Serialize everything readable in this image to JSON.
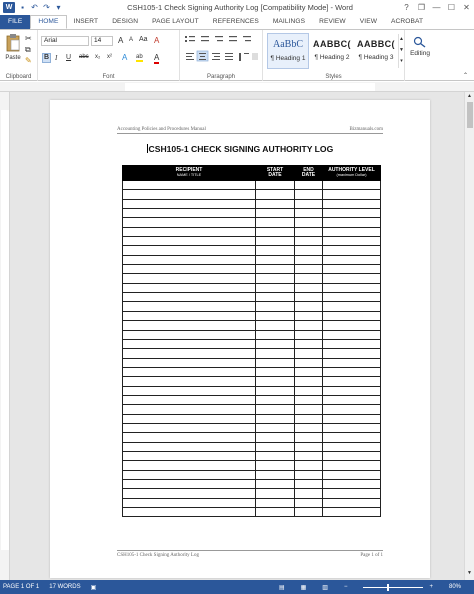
{
  "window": {
    "title": "CSH105-1 Check Signing Authority Log [Compatibility Mode] - Word",
    "help": "?",
    "restore": "❐",
    "minimize": "—",
    "maximize": "☐",
    "close": "✕"
  },
  "quick_access": {
    "app_letter": "W",
    "save": "▪",
    "undo": "↶",
    "redo": "↷",
    "customize": "▾"
  },
  "tabs": [
    "FILE",
    "HOME",
    "INSERT",
    "DESIGN",
    "PAGE LAYOUT",
    "REFERENCES",
    "MAILINGS",
    "REVIEW",
    "VIEW",
    "ACROBAT"
  ],
  "active_tab": "HOME",
  "ribbon": {
    "clipboard": {
      "label": "Clipboard",
      "paste_label": "Paste"
    },
    "font": {
      "label": "Font",
      "font_name": "Arial",
      "font_size": "14",
      "bold": "B",
      "italic": "I",
      "underline": "U",
      "strike": "abc",
      "subscript": "x₂",
      "superscript": "x²",
      "grow": "A",
      "shrink": "A",
      "change_case": "Aa",
      "clear_format": "A",
      "text_effects": "A",
      "highlight": "ab",
      "font_color": "A"
    },
    "paragraph": {
      "label": "Paragraph"
    },
    "styles": {
      "label": "Styles",
      "items": [
        {
          "sample": "AaBbC",
          "name": "¶ Heading 1"
        },
        {
          "sample": "AABBC(",
          "name": "¶ Heading 2"
        },
        {
          "sample": "AABBC(",
          "name": "¶ Heading 3"
        }
      ]
    },
    "editing": {
      "label": "Editing"
    }
  },
  "document": {
    "header_left": "Accounting Policies and Procedures Manual",
    "header_right": "Bizmanuals.com",
    "title": "CSH105-1 CHECK SIGNING AUTHORITY LOG",
    "table": {
      "columns": [
        {
          "title": "RECIPIENT",
          "sub": "NAME / TITLE"
        },
        {
          "title": "START",
          "sub2": "DATE"
        },
        {
          "title": "END",
          "sub2": "DATE"
        },
        {
          "title": "AUTHORITY LEVEL",
          "sub": "(maximum Dollar)"
        }
      ],
      "empty_rows": 36
    },
    "footer_left": "CSH105-1 Check Signing Authority Log",
    "footer_right": "Page 1 of 1"
  },
  "status": {
    "page": "PAGE 1 OF 1",
    "words": "17 WORDS",
    "zoom": "80%",
    "zoom_fraction": 0.8
  },
  "colors": {
    "accent": "#2b579a",
    "header_fill": "#000000"
  }
}
